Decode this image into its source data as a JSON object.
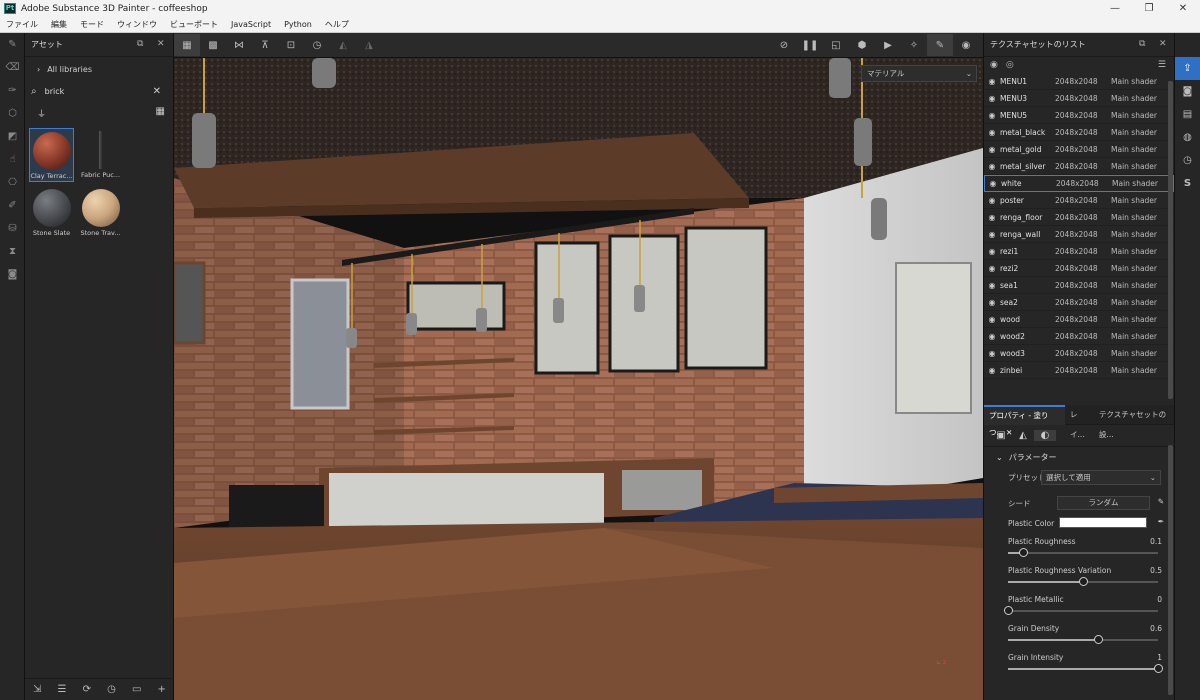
{
  "window": {
    "title": "Adobe Substance 3D Painter - coffeeshop",
    "logo": "Pt"
  },
  "menu": [
    "ファイル",
    "編集",
    "モード",
    "ウィンドウ",
    "ビューポート",
    "JavaScript",
    "Python",
    "ヘルプ"
  ],
  "assets": {
    "title": "アセット",
    "library": "All libraries",
    "search_value": "brick",
    "items": [
      {
        "label": "Clay Terrac...",
        "color": "#8a3a2a",
        "selected": true
      },
      {
        "label": "Fabric Puc...",
        "color": "#3a3a3a",
        "selected": false
      },
      {
        "label": "Stone Slate",
        "color": "#4a4d52",
        "selected": false
      },
      {
        "label": "Stone Trav...",
        "color": "#c9a57d",
        "selected": false
      }
    ]
  },
  "viewport": {
    "material_mode": "マテリアル"
  },
  "texture_sets": {
    "title": "テクスチャセットのリスト",
    "rows": [
      {
        "name": "MENU1",
        "res": "2048x2048",
        "shader": "Main shader"
      },
      {
        "name": "MENU3",
        "res": "2048x2048",
        "shader": "Main shader"
      },
      {
        "name": "MENU5",
        "res": "2048x2048",
        "shader": "Main shader"
      },
      {
        "name": "metal_black",
        "res": "2048x2048",
        "shader": "Main shader"
      },
      {
        "name": "metal_gold",
        "res": "2048x2048",
        "shader": "Main shader"
      },
      {
        "name": "metal_silver",
        "res": "2048x2048",
        "shader": "Main shader"
      },
      {
        "name": "white",
        "res": "2048x2048",
        "shader": "Main shader",
        "selected": true
      },
      {
        "name": "poster",
        "res": "2048x2048",
        "shader": "Main shader"
      },
      {
        "name": "renga_floor",
        "res": "2048x2048",
        "shader": "Main shader"
      },
      {
        "name": "renga_wall",
        "res": "2048x2048",
        "shader": "Main shader"
      },
      {
        "name": "rezi1",
        "res": "2048x2048",
        "shader": "Main shader"
      },
      {
        "name": "rezi2",
        "res": "2048x2048",
        "shader": "Main shader"
      },
      {
        "name": "sea1",
        "res": "2048x2048",
        "shader": "Main shader"
      },
      {
        "name": "sea2",
        "res": "2048x2048",
        "shader": "Main shader"
      },
      {
        "name": "wood",
        "res": "2048x2048",
        "shader": "Main shader"
      },
      {
        "name": "wood2",
        "res": "2048x2048",
        "shader": "Main shader"
      },
      {
        "name": "wood3",
        "res": "2048x2048",
        "shader": "Main shader"
      },
      {
        "name": "zinbei",
        "res": "2048x2048",
        "shader": "Main shader"
      }
    ]
  },
  "properties": {
    "tabs": [
      "プロパティ - 塗りつ...",
      "レイ...",
      "テクスチャセットの設..."
    ],
    "section": "パラメーター",
    "preset_label": "プリセット",
    "preset_value": "選択して適用",
    "seed_label": "シード",
    "seed_value": "ランダム",
    "color_label": "Plastic Color",
    "sliders": [
      {
        "name": "Plastic Roughness",
        "value": 0.1
      },
      {
        "name": "Plastic Roughness Variation",
        "value": 0.5
      },
      {
        "name": "Plastic Metallic",
        "value": 0
      },
      {
        "name": "Grain Density",
        "value": 0.6
      },
      {
        "name": "Grain Intensity",
        "value": 1
      }
    ]
  }
}
